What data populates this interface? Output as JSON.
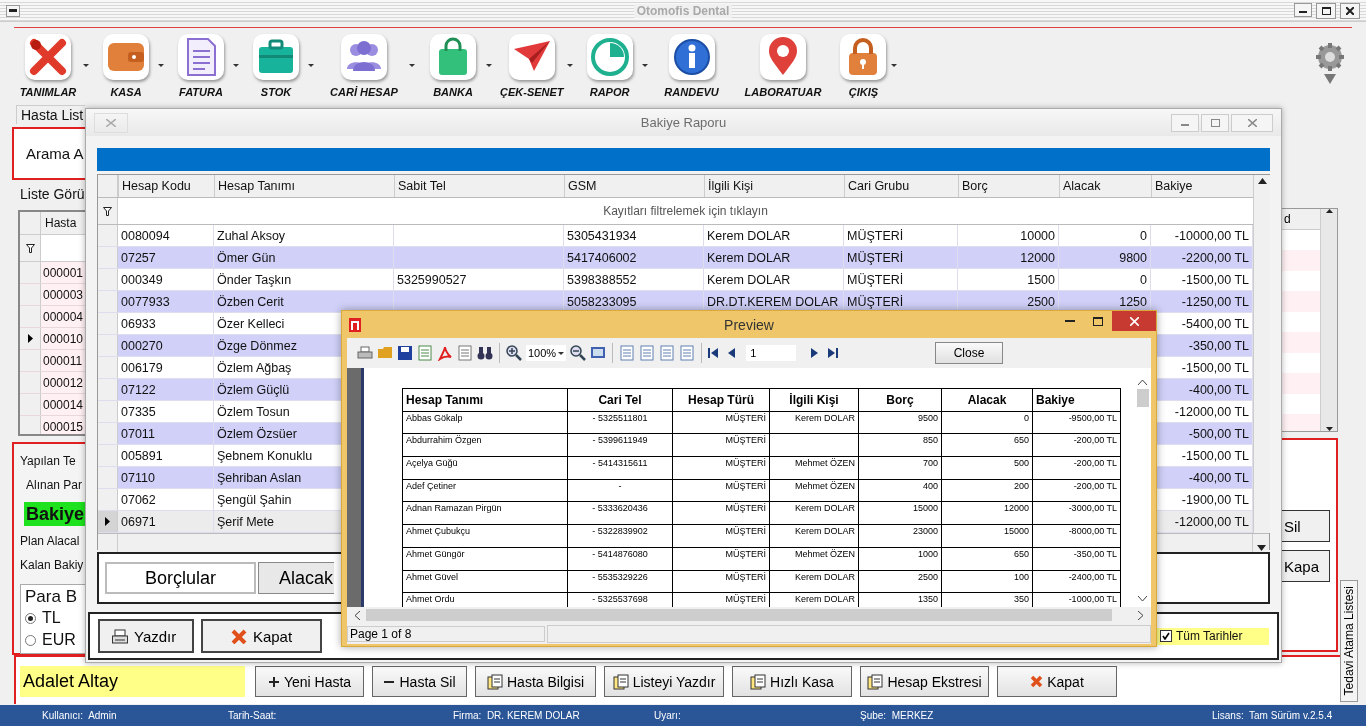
{
  "window": {
    "title": "Otomofis Dental"
  },
  "toolbar": [
    {
      "label": "TANIMLAR",
      "dropdown": true
    },
    {
      "label": "KASA",
      "dropdown": true
    },
    {
      "label": "FATURA",
      "dropdown": true
    },
    {
      "label": "STOK",
      "dropdown": true
    },
    {
      "label": "CARİ HESAP",
      "dropdown": true
    },
    {
      "label": "BANKA",
      "dropdown": true
    },
    {
      "label": "ÇEK-SENET",
      "dropdown": true
    },
    {
      "label": "RAPOR",
      "dropdown": true
    },
    {
      "label": "RANDEVU",
      "dropdown": false
    },
    {
      "label": "LABORATUAR",
      "dropdown": false
    },
    {
      "label": "ÇIKIŞ",
      "dropdown": true
    }
  ],
  "patient_panel": {
    "tab": "Hasta List",
    "search_label": "Arama A",
    "view_label": "Liste Görü",
    "grid_header": "Hasta",
    "rows": [
      {
        "code": "000001",
        "selected": false
      },
      {
        "code": "000003",
        "selected": false
      },
      {
        "code": "000004",
        "selected": false
      },
      {
        "code": "000010",
        "selected": true
      },
      {
        "code": "000011",
        "selected": false
      },
      {
        "code": "000012",
        "selected": false
      },
      {
        "code": "000014",
        "selected": false
      },
      {
        "code": "000015",
        "selected": false
      }
    ],
    "labels": [
      "Yapılan Te",
      "Alınan Par"
    ],
    "balance_label": "Bakiye",
    "labels_2": [
      "Plan Alacal",
      "Kalan Bakiy"
    ],
    "currency": {
      "title": "Para B",
      "options": [
        {
          "label": "TL",
          "selected": true
        },
        {
          "label": "EUR",
          "selected": false
        }
      ]
    }
  },
  "right_panel": {
    "column": "d",
    "buttons": [
      "Sil",
      "Kapa"
    ],
    "side_tab": "Tedavi Atama Listesi"
  },
  "report_window": {
    "title": "Bakiye Raporu",
    "columns": [
      "Hesap Kodu",
      "Hesap Tanımı",
      "Sabit Tel",
      "GSM",
      "İlgili Kişi",
      "Cari Grubu",
      "Borç",
      "Alacak",
      "Bakiye"
    ],
    "filter_hint": "Kayıtları filtrelemek için tıklayın",
    "rows": [
      {
        "code": "0080094",
        "name": "Zuhal Aksoy",
        "gsm": "5305431934",
        "contact": "Kerem DOLAR",
        "group": "MÜŞTERİ",
        "debit": "10000",
        "credit": "0",
        "balance": "-10000,00 TL",
        "selected": false
      },
      {
        "code": "07257",
        "name": "Ömer Gün",
        "gsm": "5417406002",
        "contact": "Kerem DOLAR",
        "group": "MÜŞTERİ",
        "debit": "12000",
        "credit": "9800",
        "balance": "-2200,00 TL",
        "selected": false
      },
      {
        "code": "000349",
        "name": "Önder Taşkın",
        "phone": "5325990527",
        "gsm": "5398388552",
        "contact": "Kerem DOLAR",
        "group": "MÜŞTERİ",
        "debit": "1500",
        "credit": "0",
        "balance": "-1500,00 TL",
        "selected": false
      },
      {
        "code": "0077933",
        "name": "Özben Cerit",
        "gsm": "5058233095",
        "contact": "DR.DT.KEREM DOLAR",
        "group": "MÜŞTERİ",
        "debit": "2500",
        "credit": "1250",
        "balance": "-1250,00 TL",
        "selected": false
      },
      {
        "code": "06933",
        "name": "Özer Kelleci",
        "balance": "-5400,00 TL",
        "selected": false
      },
      {
        "code": "000270",
        "name": "Özge Dönmez",
        "balance": "-350,00 TL",
        "selected": false
      },
      {
        "code": "006179",
        "name": "Özlem Ağbaş",
        "balance": "-1500,00 TL",
        "selected": false
      },
      {
        "code": "07122",
        "name": "Özlem Güçlü",
        "balance": "-400,00 TL",
        "selected": false
      },
      {
        "code": "07335",
        "name": "Özlem Tosun",
        "balance": "-12000,00 TL",
        "selected": false
      },
      {
        "code": "07011",
        "name": "Özlem Özsüer",
        "balance": "-500,00 TL",
        "selected": false
      },
      {
        "code": "005891",
        "name": "Şebnem Konuklu",
        "balance": "-1500,00 TL",
        "selected": false
      },
      {
        "code": "07110",
        "name": "Şehriban Aslan",
        "balance": "-400,00 TL",
        "selected": false
      },
      {
        "code": "07062",
        "name": "Şengül Şahin",
        "balance": "-1900,00 TL",
        "selected": false
      },
      {
        "code": "06971",
        "name": "Şerif Mete",
        "balance": "-12000,00 TL",
        "selected": true
      }
    ],
    "tabs": [
      {
        "label": "Borçlular",
        "selected": true
      },
      {
        "label": "Alacak",
        "selected": false
      }
    ],
    "buttons": [
      "Yazdır",
      "Kapat"
    ],
    "all_dates": {
      "label": "Tüm Tarihler",
      "checked": true
    }
  },
  "preview_window": {
    "title": "Preview",
    "zoom": "100%",
    "page": "1",
    "close_button": "Close",
    "columns": [
      "Hesap Tanımı",
      "Cari Tel",
      "Hesap Türü",
      "İlgili Kişi",
      "Borç",
      "Alacak",
      "Bakiye"
    ],
    "rows": [
      [
        "Abbas Gökalp",
        "- 5325511801",
        "MÜŞTERİ",
        "Kerem DOLAR",
        "9500",
        "0",
        "-9500,00 TL"
      ],
      [
        "Abdurrahim Özgen",
        "- 5399611949",
        "MÜŞTERİ",
        null,
        "850",
        "650",
        "-200,00 TL"
      ],
      [
        "Açelya Güğü",
        "- 5414315611",
        "MÜŞTERİ",
        "Mehmet ÖZEN",
        "700",
        "500",
        "-200,00 TL"
      ],
      [
        "Adef Çetiner",
        "-",
        "MÜŞTERİ",
        "Mehmet ÖZEN",
        "400",
        "200",
        "-200,00 TL"
      ],
      [
        "Adnan Ramazan Pirgün",
        "- 5333620436",
        "MÜŞTERİ",
        "Kerem DOLAR",
        "15000",
        "12000",
        "-3000,00 TL"
      ],
      [
        "Ahmet Çubukçu",
        "- 5322839902",
        "MÜŞTERİ",
        "Kerem DOLAR",
        "23000",
        "15000",
        "-8000,00 TL"
      ],
      [
        "Ahmet Güngör",
        "- 5414876080",
        "MÜŞTERİ",
        "Mehmet ÖZEN",
        "1000",
        "650",
        "-350,00 TL"
      ],
      [
        "Ahmet Güvel",
        "- 5535329226",
        "MÜŞTERİ",
        "Kerem DOLAR",
        "2500",
        "100",
        "-2400,00 TL"
      ],
      [
        "Ahmet Ordu",
        "- 5325537698",
        "MÜŞTERİ",
        "Kerem DOLAR",
        "1350",
        "350",
        "-1000,00 TL"
      ]
    ],
    "status": "Page 1 of 8"
  },
  "bottom_bar": {
    "patient": "Adalet Altay",
    "buttons": [
      "Yeni Hasta",
      "Hasta Sil",
      "Hasta Bilgisi",
      "Listeyi Yazdır",
      "Hızlı Kasa",
      "Hesap Ekstresi",
      "Kapat"
    ]
  },
  "status_bar": [
    "Kullanıcı:  Admin",
    "Tarih-Saat:",
    "Firma:  DR. KEREM DOLAR",
    "Uyarı:",
    "Şube:  MERKEZ",
    "Lisans:  Tam Sürüm v.2.5.4"
  ]
}
